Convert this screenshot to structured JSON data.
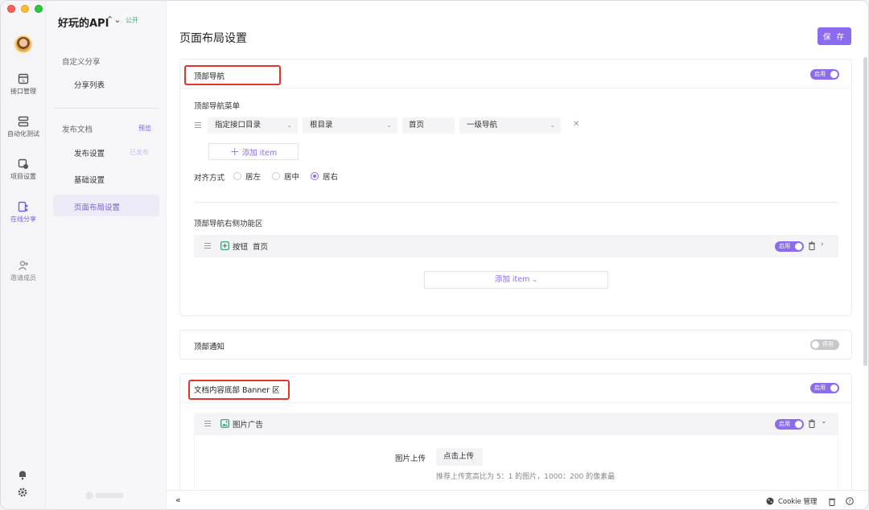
{
  "window": {
    "traffic": [
      "close",
      "minimize",
      "zoom"
    ]
  },
  "rail": {
    "items": [
      {
        "label": "接口管理",
        "icon": "api-grid-icon"
      },
      {
        "label": "自动化测试",
        "icon": "automation-icon"
      },
      {
        "label": "项目设置",
        "icon": "project-settings-icon"
      },
      {
        "label": "在线分享",
        "icon": "share-icon",
        "active": true
      },
      {
        "label": "邀请成员",
        "icon": "invite-member-icon"
      }
    ],
    "bottom_icons": [
      "bell-icon",
      "gear-icon"
    ]
  },
  "sidebar": {
    "project_name": "好玩的API",
    "project_switch_glyph": "⌃⌄",
    "visibility": "公开",
    "group1": "自定义分享",
    "share_list": "分享列表",
    "group2": "发布文档",
    "preview": "预览",
    "publish_settings": "发布设置",
    "published": "已发布",
    "basic_settings": "基础设置",
    "layout_settings": "页面布局设置"
  },
  "main": {
    "title": "页面布局设置",
    "save": "保 存",
    "top_nav": {
      "title": "顶部导航",
      "toggle": "启用",
      "menu_label": "顶部导航菜单",
      "row": {
        "type": "指定接口目录",
        "directory": "根目录",
        "name": "首页",
        "level": "一级导航",
        "remove": "✕"
      },
      "add_item": "添加 item",
      "align_label": "对齐方式",
      "align_options": [
        "居左",
        "居中",
        "居右"
      ],
      "align_selected": 2,
      "right_label": "顶部导航右侧功能区",
      "right_item": {
        "kind": "按钮",
        "name": "首页",
        "toggle": "启用"
      },
      "add_item2": "添加 item"
    },
    "top_notice": {
      "title": "顶部通知",
      "toggle": "停用"
    },
    "banner": {
      "title": "文档内容底部 Banner 区",
      "toggle": "启用",
      "item": {
        "name": "图片广告",
        "toggle": "启用"
      },
      "upload_label": "图片上传",
      "upload_button": "点击上传",
      "upload_hint": "推荐上传宽高比为 5：1 的图片，1000：200 的像素最"
    }
  },
  "bottombar": {
    "collapse": "«",
    "cookie": "Cookie 管理"
  },
  "colors": {
    "accent": "#8b6cf0",
    "highlight": "#e4342b",
    "public": "#3fb06b"
  }
}
